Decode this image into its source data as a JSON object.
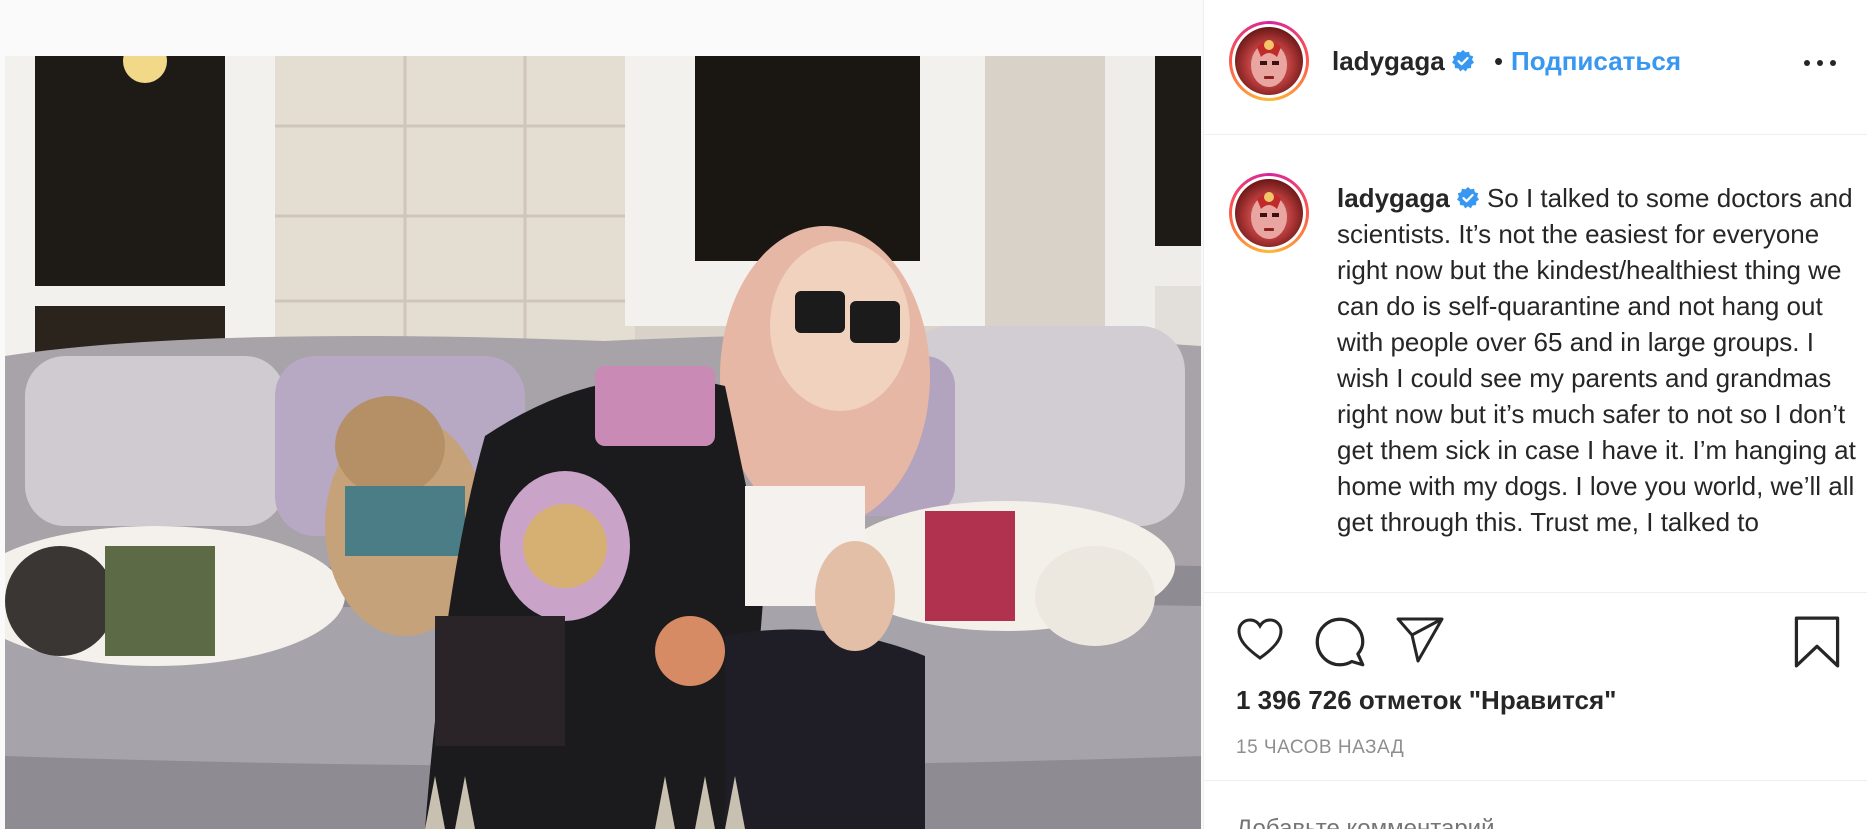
{
  "post": {
    "username": "ladygaga",
    "follow_label": "Подписаться",
    "separator": "•",
    "caption": "So I talked to some doctors and scientists. It’s not the easiest for everyone right now but the kindest/healthiest thing we can do is self-quarantine and not hang out with people over 65 and in large groups. I wish I could see my parents and grandmas right now but it’s much safer to not so I don’t get them sick in case I have it. I’m hanging at home with my dogs. I love you world, we’ll all get through this. Trust me, I talked to",
    "likes_text": "1 396 726 отметок \"Нравится\"",
    "time_text": "15 ЧАСОВ НАЗАД",
    "comment_placeholder": "Добавьте комментарий..."
  },
  "icons": {
    "verified": "verified-badge-icon",
    "more": "more-options-icon",
    "like": "heart-icon",
    "comment": "comment-bubble-icon",
    "share": "paper-plane-icon",
    "save": "bookmark-icon"
  },
  "colors": {
    "link_blue": "#3897f0",
    "verified_blue": "#3897f0",
    "text": "#262626",
    "muted": "#8e8e8e",
    "divider": "#efefef"
  }
}
